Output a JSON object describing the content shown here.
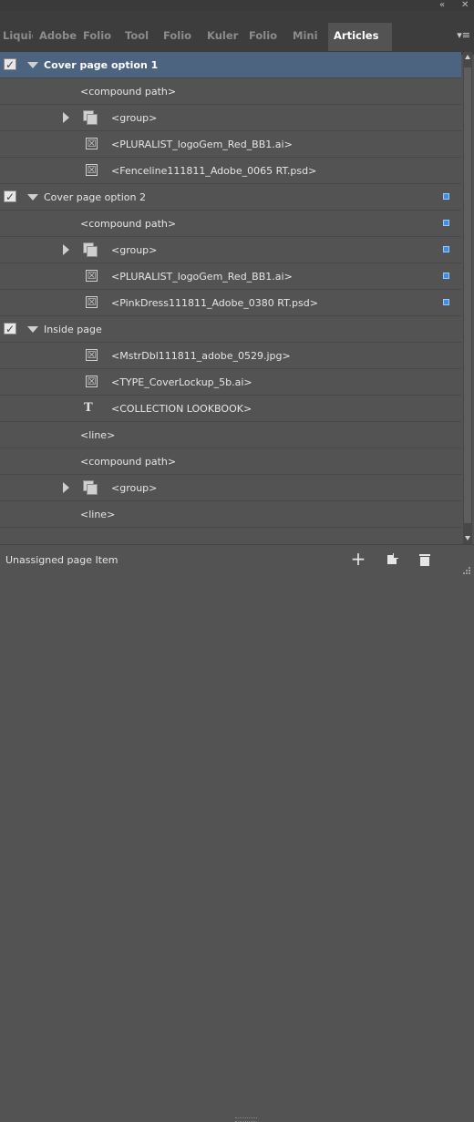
{
  "window_buttons": {
    "collapse": "«",
    "close": "✕"
  },
  "tabs": [
    {
      "label": "Liquid Layout"
    },
    {
      "label": "Adobe"
    },
    {
      "label": "Folio"
    },
    {
      "label": "Tool"
    },
    {
      "label": "Folio"
    },
    {
      "label": "Kuler"
    },
    {
      "label": "Folio"
    },
    {
      "label": "Mini"
    },
    {
      "label": "Articles"
    }
  ],
  "panel_menu_icon": "▾≡",
  "checkmark_glyph": "✓",
  "image_icon_glyph": "☒",
  "text_icon_glyph": "T",
  "rows": [
    {
      "label": "Cover page option 1",
      "selected": true
    },
    {
      "label": "<compound path>"
    },
    {
      "label": "<group>"
    },
    {
      "label": "<PLURALIST_logoGem_Red_BB1.ai>"
    },
    {
      "label": "<Fenceline111811_Adobe_0065 RT.psd>"
    },
    {
      "label": "Cover page option 2"
    },
    {
      "label": "<compound path>"
    },
    {
      "label": "<group>"
    },
    {
      "label": "<PLURALIST_logoGem_Red_BB1.ai>"
    },
    {
      "label": "<PinkDress111811_Adobe_0380 RT.psd>"
    },
    {
      "label": "Inside page"
    },
    {
      "label": "<MstrDbl111811_adobe_0529.jpg>"
    },
    {
      "label": "<TYPE_CoverLockup_5b.ai>"
    },
    {
      "label": "<COLLECTION LOOKBOOK>"
    },
    {
      "label": "<line>"
    },
    {
      "label": "<compound path>"
    },
    {
      "label": "<group>"
    },
    {
      "label": "<line>"
    }
  ],
  "footer": {
    "status": "Unassigned page Item",
    "add_glyph": "+"
  },
  "colors": {
    "panel_bg": "#535353",
    "selected_row": "#4d6480",
    "marker_blue": "#3a8fe8"
  }
}
